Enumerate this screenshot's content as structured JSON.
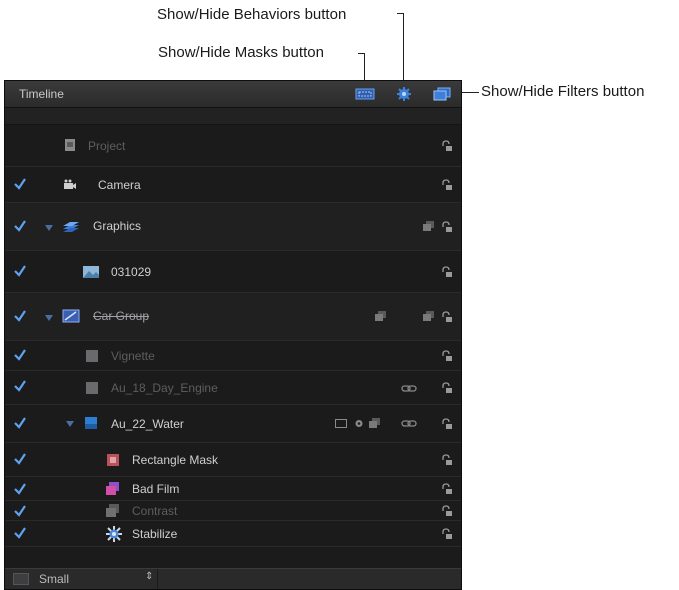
{
  "callouts": {
    "behaviors": "Show/Hide Behaviors button",
    "masks": "Show/Hide Masks button",
    "filters": "Show/Hide Filters button"
  },
  "panel": {
    "title": "Timeline",
    "header_buttons": [
      "masks",
      "behaviors",
      "filters"
    ],
    "colors": {
      "accent": "#3d7fd9",
      "background": "#1b1b1c"
    }
  },
  "layers": [
    {
      "name": "Project",
      "checked": false,
      "expand": false,
      "dim": true,
      "icon": "project-icon"
    },
    {
      "name": "Camera",
      "checked": true,
      "expand": false,
      "dim": false,
      "icon": "camera-icon"
    },
    {
      "name": "Graphics",
      "checked": true,
      "expand": true,
      "dim": false,
      "icon": "group-icon"
    },
    {
      "name": "031029",
      "checked": true,
      "expand": false,
      "dim": false,
      "icon": "image-icon"
    },
    {
      "name": "Car Group",
      "checked": true,
      "expand": true,
      "dim": false,
      "icon": "group-icon"
    },
    {
      "name": "Vignette",
      "checked": true,
      "expand": false,
      "dim": true,
      "icon": "layer-icon"
    },
    {
      "name": "Au_18_Day_Engine",
      "checked": true,
      "expand": false,
      "dim": true,
      "icon": "layer-icon"
    },
    {
      "name": "Au_22_Water",
      "checked": true,
      "expand": true,
      "dim": false,
      "icon": "layer-icon"
    },
    {
      "name": "Rectangle Mask",
      "checked": true,
      "expand": false,
      "dim": false,
      "icon": "mask-icon"
    },
    {
      "name": "Bad Film",
      "checked": true,
      "expand": false,
      "dim": false,
      "icon": "filter-icon"
    },
    {
      "name": "Contrast",
      "checked": true,
      "expand": false,
      "dim": true,
      "icon": "filter-icon"
    },
    {
      "name": "Stabilize",
      "checked": true,
      "expand": false,
      "dim": false,
      "icon": "behavior-icon"
    }
  ],
  "footer": {
    "size_label": "Small"
  }
}
